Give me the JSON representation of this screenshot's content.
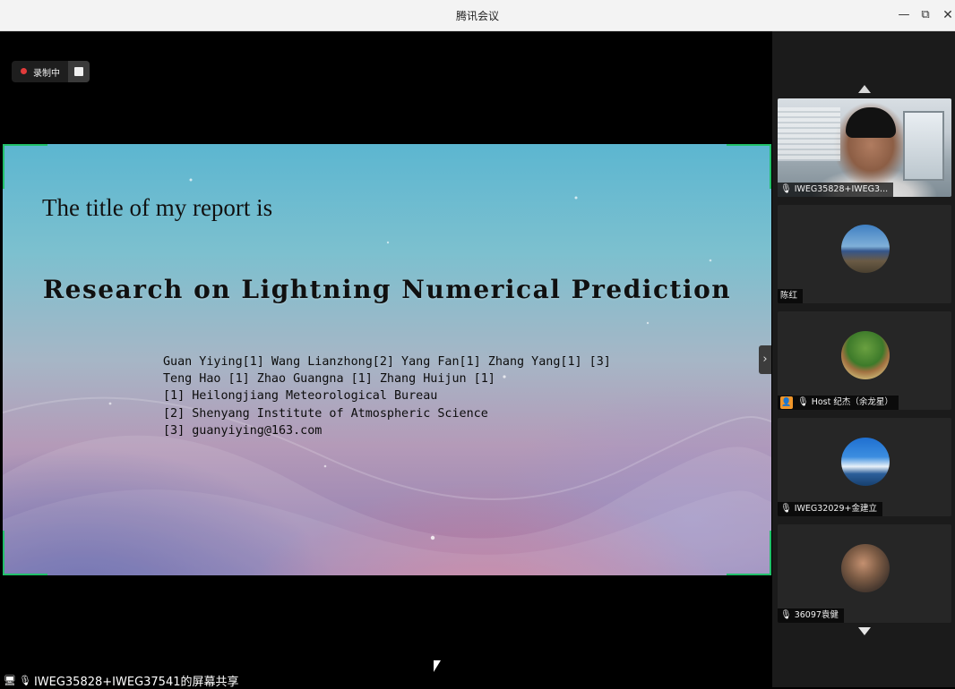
{
  "window": {
    "title": "腾讯会议",
    "minimize_icon": "—",
    "maximize_icon": "⧉",
    "close_icon": "✕"
  },
  "recording": {
    "label": "录制中"
  },
  "slide": {
    "intro": "The title of my report is",
    "heading": "Research on Lightning Numerical Prediction",
    "authors": [
      "Guan Yiying[1] Wang Lianzhong[2] Yang Fan[1] Zhang Yang[1] [3]",
      "Teng Hao [1] Zhao Guangna [1] Zhang Huijun [1]",
      "[1] Heilongjiang Meteorological Bureau",
      "[2] Shenyang Institute of Atmospheric Science",
      "[3] guanyiying@163.com"
    ]
  },
  "panel": {
    "collapse_icon": "›",
    "participants": [
      {
        "name": "IWEG35828+IWEG3...",
        "mic": "🎙"
      },
      {
        "name": "陈红"
      },
      {
        "name": "Host 纪杰（余龙星）",
        "mic": "🎙",
        "host_icon": "👤"
      },
      {
        "name": "IWEG32029+金建立",
        "mic": "🎙"
      },
      {
        "name": "36097袁健",
        "mic": "🎙"
      }
    ]
  },
  "share_banner": {
    "text": "IWEG35828+IWEG37541的屏幕共享"
  },
  "colors": {
    "frame_green": "#21c06a",
    "record_red": "#e23b3b",
    "host_orange": "#f0962a"
  }
}
